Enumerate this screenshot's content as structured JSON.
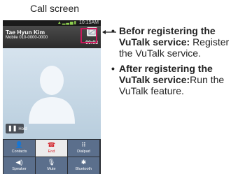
{
  "caption": "Call screen",
  "phone": {
    "status_time": "10:15AM",
    "caller_name": "Tae Hyun Kim",
    "caller_number": "Mobile 010-0000-0000",
    "duration": "00:03",
    "hold_label": "Hold",
    "buttons": [
      {
        "label": "Contacts",
        "icon": "contacts-icon"
      },
      {
        "label": "End",
        "icon": "end-call-icon"
      },
      {
        "label": "Dialpad",
        "icon": "dialpad-icon"
      },
      {
        "label": "Speaker",
        "icon": "speaker-icon"
      },
      {
        "label": "Mute",
        "icon": "mute-icon"
      },
      {
        "label": "Bluetooth",
        "icon": "bluetooth-icon"
      }
    ]
  },
  "notes": [
    {
      "heading": "Befor registering the VuTalk service:",
      "body": "Register the VuTalk service."
    },
    {
      "heading": "After registering the VuTalk service:",
      "body": "Run the VuTalk feature."
    }
  ],
  "colors": {
    "highlight": "#c8175a",
    "button": "#5b6f8c",
    "end": "#d2232a"
  }
}
